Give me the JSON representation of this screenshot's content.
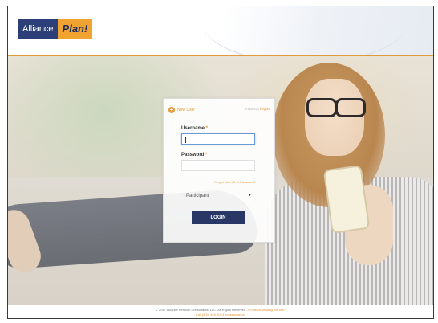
{
  "header": {
    "logo_left": "Alliance",
    "logo_right": "Plan!"
  },
  "login": {
    "new_user": "New User",
    "language_other": "Espanol",
    "language_sep": "|",
    "language_active": "English",
    "username_label": "Username",
    "password_label": "Password",
    "required_mark": "*",
    "username_value": "",
    "password_value": "",
    "forgot_link": "Forgot User ID or Password?",
    "role_selected": "Participant",
    "login_button": "LOGIN"
  },
  "footer": {
    "copyright": "© 2017 Alliance Pension Consultants, LLC. All Rights Reserved.",
    "problems": "Problems viewing the site?",
    "call": "Call (800) 480-4014 for assistance."
  },
  "colors": {
    "brand_navy": "#283766",
    "accent_orange": "#e39a3b"
  },
  "icons": [
    "plus-icon",
    "chevron-down-icon"
  ]
}
